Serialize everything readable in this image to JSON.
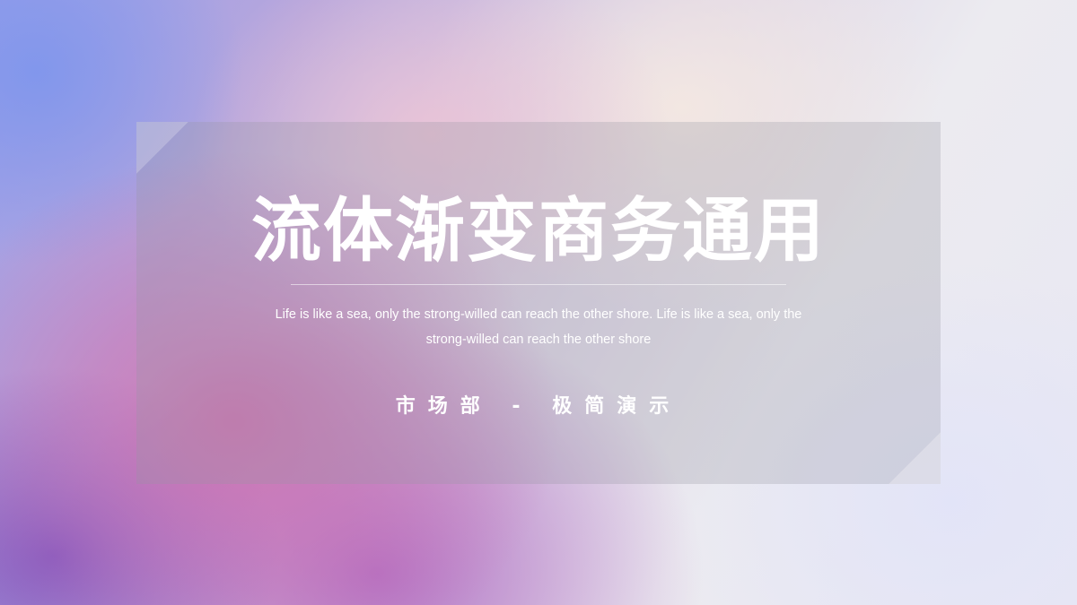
{
  "slide": {
    "title": "流体渐变商务通用",
    "subtitle": "Life is like a sea, only the strong-willed can reach the other shore. Life is like a sea, only the strong-willed can reach the other shore",
    "department": "市场部 - 极简演示"
  },
  "colors": {
    "text": "#ffffff",
    "gradient_blue": "#8096ec",
    "gradient_pink": "#ce70b0",
    "gradient_purple": "#7850be",
    "gradient_light": "#ecebf0"
  }
}
